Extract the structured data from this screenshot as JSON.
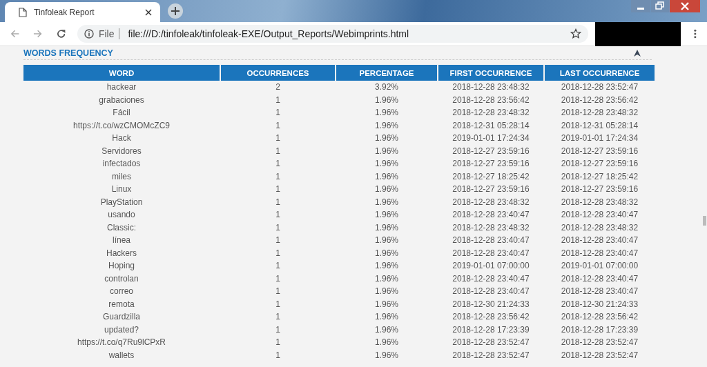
{
  "window": {
    "tab_title": "Tinfoleak Report"
  },
  "toolbar": {
    "scheme_label": "File",
    "url": "file:///D:/tinfoleak/tinfoleak-EXE/Output_Reports/Webimprints.html"
  },
  "section": {
    "title": "WORDS FREQUENCY"
  },
  "table": {
    "columns": [
      "WORD",
      "OCCURRENCES",
      "PERCENTAGE",
      "FIRST OCCURRENCE",
      "LAST OCCURRENCE"
    ],
    "rows": [
      [
        "hackear",
        "2",
        "3.92%",
        "2018-12-28 23:48:32",
        "2018-12-28 23:52:47"
      ],
      [
        "grabaciones",
        "1",
        "1.96%",
        "2018-12-28 23:56:42",
        "2018-12-28 23:56:42"
      ],
      [
        "Fácil",
        "1",
        "1.96%",
        "2018-12-28 23:48:32",
        "2018-12-28 23:48:32"
      ],
      [
        "https://t.co/wzCMOMcZC9",
        "1",
        "1.96%",
        "2018-12-31 05:28:14",
        "2018-12-31 05:28:14"
      ],
      [
        "Hack",
        "1",
        "1.96%",
        "2019-01-01 17:24:34",
        "2019-01-01 17:24:34"
      ],
      [
        "Servidores",
        "1",
        "1.96%",
        "2018-12-27 23:59:16",
        "2018-12-27 23:59:16"
      ],
      [
        "infectados",
        "1",
        "1.96%",
        "2018-12-27 23:59:16",
        "2018-12-27 23:59:16"
      ],
      [
        "miles",
        "1",
        "1.96%",
        "2018-12-27 18:25:42",
        "2018-12-27 18:25:42"
      ],
      [
        "Linux",
        "1",
        "1.96%",
        "2018-12-27 23:59:16",
        "2018-12-27 23:59:16"
      ],
      [
        "PlayStation",
        "1",
        "1.96%",
        "2018-12-28 23:48:32",
        "2018-12-28 23:48:32"
      ],
      [
        "usando",
        "1",
        "1.96%",
        "2018-12-28 23:40:47",
        "2018-12-28 23:40:47"
      ],
      [
        "Classic:",
        "1",
        "1.96%",
        "2018-12-28 23:48:32",
        "2018-12-28 23:48:32"
      ],
      [
        "línea",
        "1",
        "1.96%",
        "2018-12-28 23:40:47",
        "2018-12-28 23:40:47"
      ],
      [
        "Hackers",
        "1",
        "1.96%",
        "2018-12-28 23:40:47",
        "2018-12-28 23:40:47"
      ],
      [
        "Hoping",
        "1",
        "1.96%",
        "2019-01-01 07:00:00",
        "2019-01-01 07:00:00"
      ],
      [
        "controlan",
        "1",
        "1.96%",
        "2018-12-28 23:40:47",
        "2018-12-28 23:40:47"
      ],
      [
        "correo",
        "1",
        "1.96%",
        "2018-12-28 23:40:47",
        "2018-12-28 23:40:47"
      ],
      [
        "remota",
        "1",
        "1.96%",
        "2018-12-30 21:24:33",
        "2018-12-30 21:24:33"
      ],
      [
        "Guardzilla",
        "1",
        "1.96%",
        "2018-12-28 23:56:42",
        "2018-12-28 23:56:42"
      ],
      [
        "updated?",
        "1",
        "1.96%",
        "2018-12-28 17:23:39",
        "2018-12-28 17:23:39"
      ],
      [
        "https://t.co/q7Ru9lCPxR",
        "1",
        "1.96%",
        "2018-12-28 23:52:47",
        "2018-12-28 23:52:47"
      ],
      [
        "wallets",
        "1",
        "1.96%",
        "2018-12-28 23:52:47",
        "2018-12-28 23:52:47"
      ]
    ]
  }
}
